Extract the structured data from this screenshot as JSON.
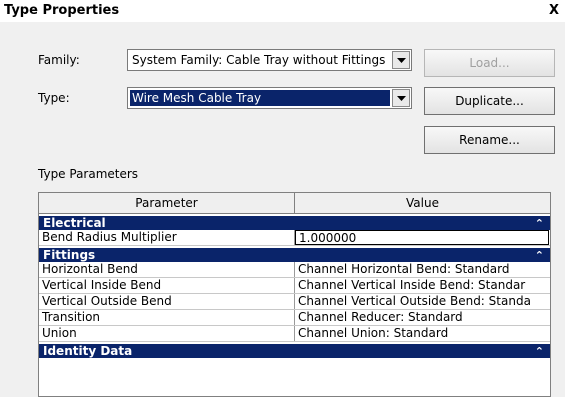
{
  "window": {
    "title": "Type Properties",
    "close_glyph": "X"
  },
  "family": {
    "label": "Family:",
    "value": "System Family: Cable Tray without Fittings"
  },
  "type": {
    "label": "Type:",
    "value": "Wire Mesh Cable Tray"
  },
  "buttons": {
    "load": "Load...",
    "duplicate": "Duplicate...",
    "rename": "Rename..."
  },
  "type_parameters": {
    "label": "Type Parameters",
    "headers": {
      "parameter": "Parameter",
      "value": "Value"
    },
    "groups": [
      {
        "name": "Electrical",
        "rows": [
          {
            "parameter": "Bend Radius Multiplier",
            "value": "1.000000"
          }
        ]
      },
      {
        "name": "Fittings",
        "rows": [
          {
            "parameter": "Horizontal Bend",
            "value": "Channel Horizontal Bend: Standard"
          },
          {
            "parameter": "Vertical Inside Bend",
            "value": "Channel Vertical Inside Bend: Standar"
          },
          {
            "parameter": "Vertical Outside Bend",
            "value": "Channel Vertical Outside Bend: Standa"
          },
          {
            "parameter": "Transition",
            "value": "Channel Reducer: Standard"
          },
          {
            "parameter": "Union",
            "value": "Channel Union: Standard"
          }
        ]
      },
      {
        "name": "Identity Data",
        "rows": []
      }
    ],
    "collapse_glyph": "»"
  },
  "colors": {
    "selection": "#0a246a",
    "group_header": "#0a246a"
  }
}
